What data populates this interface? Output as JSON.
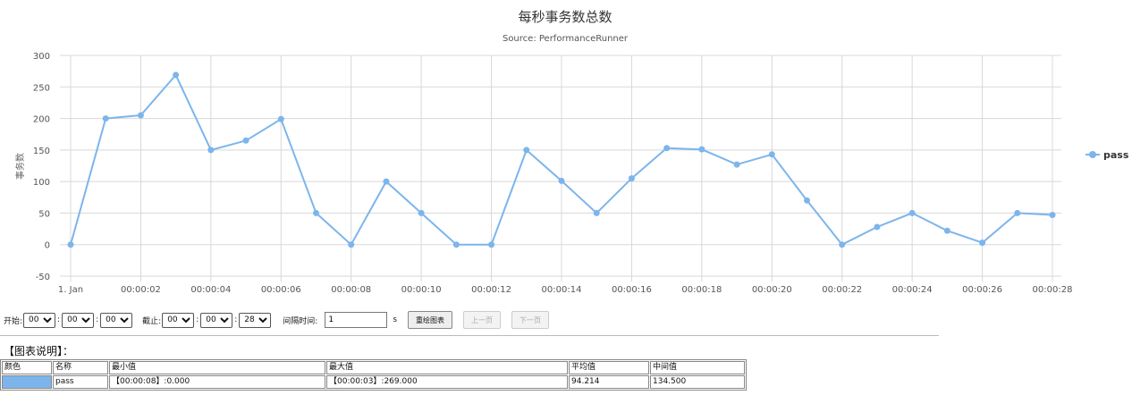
{
  "chart_data": {
    "type": "line",
    "title": "每秒事务数总数",
    "subtitle": "Source: PerformanceRunner",
    "ylabel": "事务数",
    "ylim": [
      -50,
      300
    ],
    "yticks": [
      300,
      250,
      200,
      150,
      100,
      50,
      0,
      -50
    ],
    "xticks": [
      "1. Jan",
      "00:00:02",
      "00:00:04",
      "00:00:06",
      "00:00:08",
      "00:00:10",
      "00:00:12",
      "00:00:14",
      "00:00:16",
      "00:00:18",
      "00:00:20",
      "00:00:22",
      "00:00:24",
      "00:00:26",
      "00:00:28"
    ],
    "xlim": [
      0,
      28
    ],
    "legend_position": "right",
    "grid": true,
    "series": [
      {
        "name": "pass",
        "color": "#7cb5ec",
        "x": [
          0,
          1,
          2,
          3,
          4,
          5,
          6,
          7,
          8,
          9,
          10,
          11,
          12,
          13,
          14,
          15,
          16,
          17,
          18,
          19,
          20,
          21,
          22,
          23,
          24,
          25,
          26,
          27,
          28
        ],
        "values": [
          0,
          200,
          205,
          269,
          150,
          165,
          199,
          50,
          0,
          100,
          50,
          0,
          0,
          150,
          101,
          50,
          105,
          153,
          151,
          127,
          143,
          70,
          0,
          28,
          50,
          22,
          3,
          50,
          47
        ]
      }
    ]
  },
  "controls": {
    "start_label": "开始:",
    "start": [
      "00",
      "00",
      "00"
    ],
    "end_label": "截止:",
    "end": [
      "00",
      "00",
      "28"
    ],
    "interval_label": "间隔时间:",
    "interval_value": "1",
    "interval_unit": "s",
    "redraw_button": "重绘图表",
    "prev_button": "上一页",
    "next_button": "下一页"
  },
  "legend_section": {
    "title": "【图表说明】：",
    "headers": [
      "颜色",
      "名称",
      "最小值",
      "最大值",
      "平均值",
      "中间值"
    ],
    "rows": [
      {
        "color": "#7cb5ec",
        "name": "pass",
        "min": "【00:00:08】:0.000",
        "max": "【00:00:03】:269.000",
        "avg": "94.214",
        "median": "134.500"
      }
    ]
  }
}
